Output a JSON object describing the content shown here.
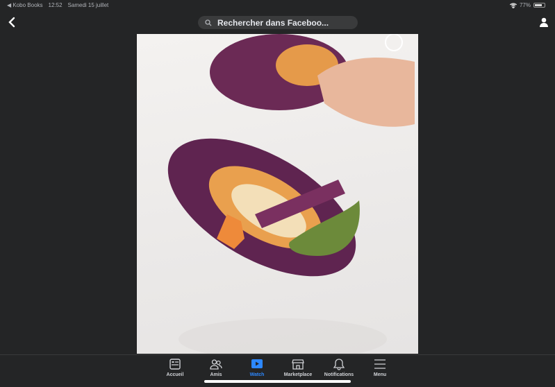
{
  "status_bar": {
    "back_app": "◀ Kobo Books",
    "time": "12:52",
    "date": "Samedi 15 juillet",
    "battery": "77%",
    "battery_level": 0.77
  },
  "header": {
    "search_placeholder": "Rechercher dans Faceboo..."
  },
  "tabs": [
    {
      "label": "Accueil",
      "icon": "home-feed-icon",
      "active": false
    },
    {
      "label": "Amis",
      "icon": "friends-icon",
      "active": false
    },
    {
      "label": "Watch",
      "icon": "watch-play-icon",
      "active": true
    },
    {
      "label": "Marketplace",
      "icon": "store-icon",
      "active": false
    },
    {
      "label": "Notifications",
      "icon": "bell-icon",
      "active": false
    },
    {
      "label": "Menu",
      "icon": "hamburger-menu-icon",
      "active": false
    }
  ],
  "colors": {
    "background": "#242526",
    "accent": "#2d88ff"
  }
}
